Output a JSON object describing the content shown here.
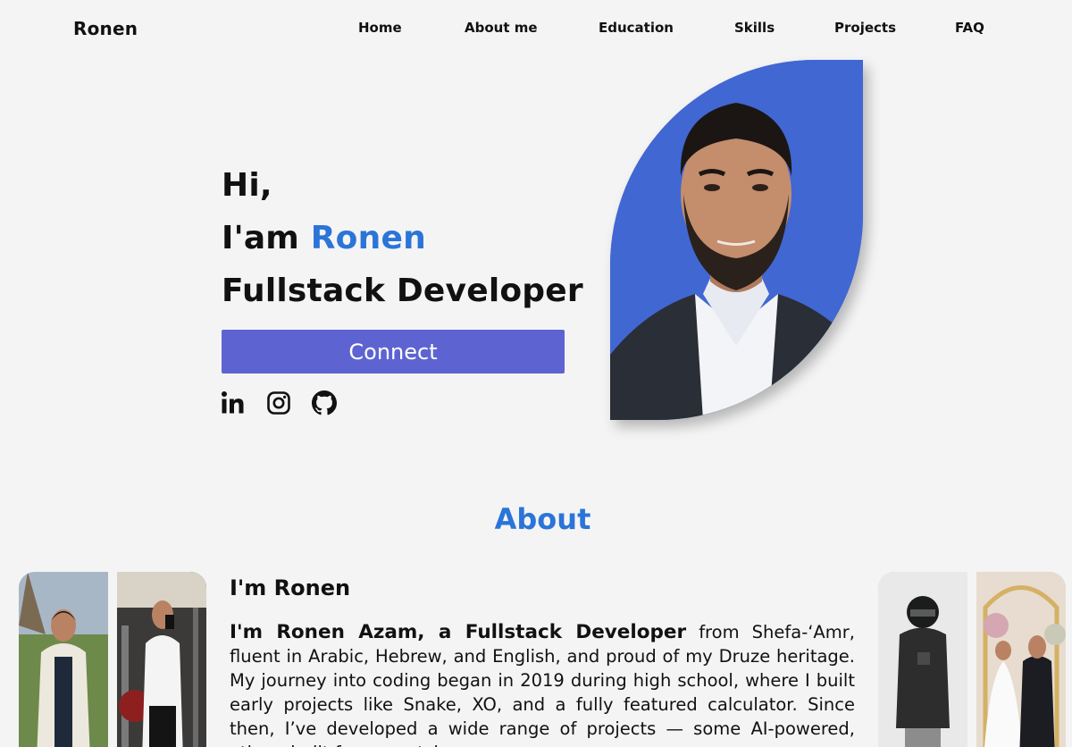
{
  "nav": {
    "logo": "Ronen",
    "items": [
      "Home",
      "About me",
      "Education",
      "Skills",
      "Projects",
      "FAQ"
    ]
  },
  "hero": {
    "greeting": "Hi,",
    "intro_prefix": "I'am ",
    "name": "Ronen",
    "role": "Fullstack Developer",
    "cta_label": "Connect",
    "socials": [
      "linkedin-icon",
      "instagram-icon",
      "github-icon"
    ]
  },
  "about": {
    "title": "About",
    "subtitle": "I'm Ronen",
    "lead": "I'm Ronen Azam, a Fullstack Developer",
    "body": " from Shefa-‘Amr, fluent in Arabic, Hebrew, and English, and proud of my Druze heritage. My journey into coding began in 2019 during high school, where I built early projects like Snake, XO, and a fully featured calculator. Since then, I’ve developed a wide range of projects — some AI-powered, others built from scratch"
  },
  "colors": {
    "accent": "#2b74d8",
    "button": "#5d64d1",
    "portrait_bg": "#4167d3",
    "page_bg": "#f4f4f4"
  }
}
